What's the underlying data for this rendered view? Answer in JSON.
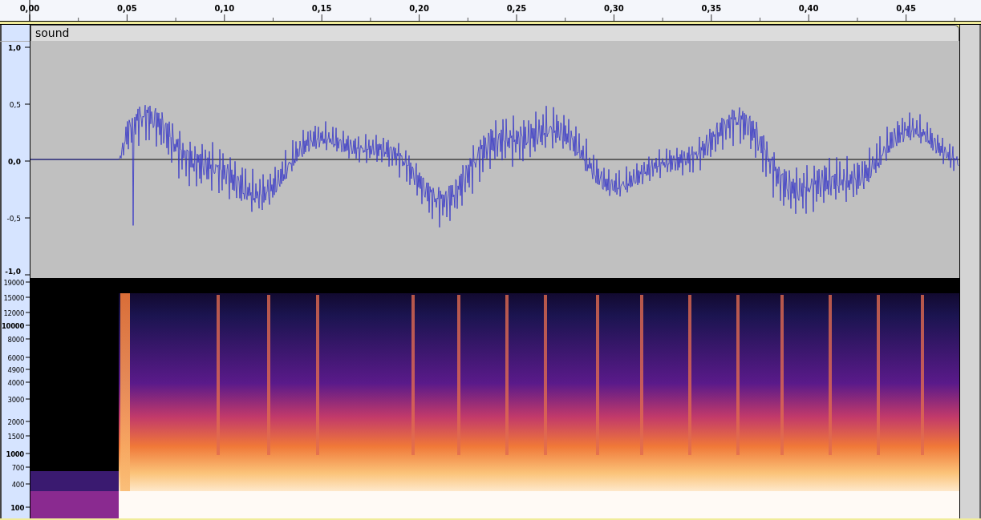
{
  "timeline_ruler": {
    "ticks": [
      "0,00",
      "0,05",
      "0,10",
      "0,15",
      "0,20",
      "0,25",
      "0,30",
      "0,35",
      "0,40",
      "0,45"
    ]
  },
  "track": {
    "name": "sound",
    "waveform_scale": {
      "ticks": [
        "1,0",
        "0,5",
        "0,0",
        "-0,5",
        "-1,0"
      ]
    },
    "spectrogram_scale": {
      "ticks": [
        "19000",
        "15000",
        "12000",
        "10000",
        "8000",
        "6000",
        "4900",
        "4000",
        "3000",
        "2000",
        "1500",
        "1000",
        "700",
        "400",
        "100"
      ]
    }
  }
}
